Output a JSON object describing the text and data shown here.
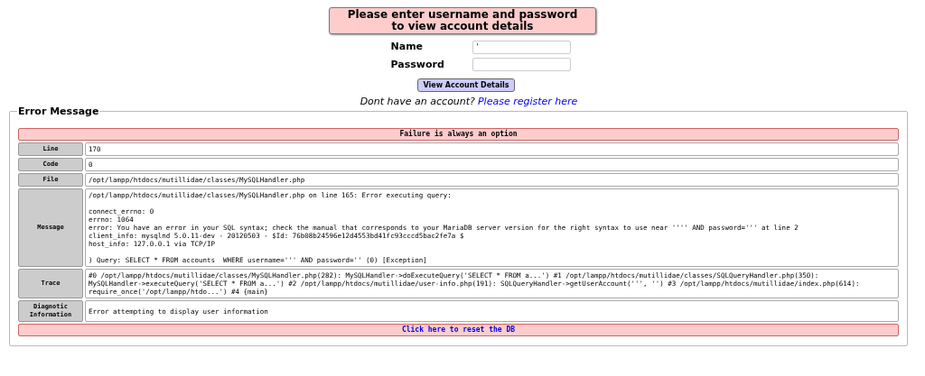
{
  "login_header": "Please enter username and password\nto view account details",
  "fields": [
    {
      "label": "Name",
      "value": "'"
    },
    {
      "label": "Password"
    }
  ],
  "submit_button": "View Account Details",
  "register": {
    "text": "Dont have an account?",
    "link": "Please register here"
  },
  "error_box": {
    "legend": "Error Message",
    "title": "Failure is always an option",
    "rows": [
      {
        "label": "Line",
        "paragraphs": [
          "170"
        ]
      },
      {
        "label": "Code",
        "paragraphs": [
          "0"
        ]
      },
      {
        "label": "File",
        "paragraphs": [
          "/opt/lampp/htdocs/mutillidae/classes/MySQLHandler.php"
        ]
      },
      {
        "label": "Message",
        "paragraphs": [
          "/opt/lampp/htdocs/mutillidae/classes/MySQLHandler.php on line 165: Error executing query:",
          "connect_errno: 0\nerrno: 1064\nerror: You have an error in your SQL syntax; check the manual that corresponds to your MariaDB server version for the right syntax to use near '''' AND password=''' at line 2\nclient_info: mysqlnd 5.0.11-dev - 20120503 - $Id: 76b08b24596e12d4553bd41fc93cccd5bac2fe7a $\nhost_info: 127.0.0.1 via TCP/IP",
          ") Query: SELECT * FROM accounts  WHERE username=''' AND password='' (0) [Exception]"
        ]
      },
      {
        "label": "Trace",
        "paragraphs": [
          "#0 /opt/lampp/htdocs/mutillidae/classes/MySQLHandler.php(282): MySQLHandler->doExecuteQuery('SELECT * FROM a...') #1 /opt/lampp/htdocs/mutillidae/classes/SQLQueryHandler.php(350):\nMySQLHandler->executeQuery('SELECT * FROM a...') #2 /opt/lampp/htdocs/mutillidae/user-info.php(191): SQLQueryHandler->getUserAccount(''', '') #3 /opt/lampp/htdocs/mutillidae/index.php(614):\nrequire_once('/opt/lampp/htdo...') #4 {main}"
        ]
      },
      {
        "label": "Diagnotic\nInformation",
        "paragraphs": [
          "Error attempting to display user information"
        ]
      }
    ],
    "reset_link": "Click here to reset the DB"
  }
}
